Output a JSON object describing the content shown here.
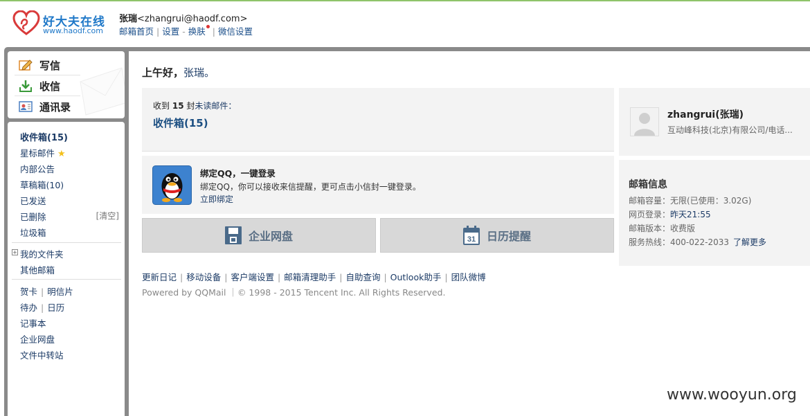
{
  "header": {
    "logo_name": "好大夫在线",
    "logo_url": "www.haodf.com",
    "user_name": "张瑞",
    "user_email": "<zhangrui@haodf.com>",
    "nav": [
      "邮箱首页",
      "设置",
      "换肤",
      "微信设置"
    ],
    "nav_dot_color": "#d33333"
  },
  "sidebar_top": {
    "compose": "写信",
    "receive": "收信",
    "contacts": "通讯录"
  },
  "sidebar": {
    "inbox": "收件箱(15)",
    "starred": "星标邮件",
    "notice": "内部公告",
    "drafts": "草稿箱(10)",
    "sent": "已发送",
    "deleted": "已删除",
    "clear": "[清空]",
    "trash": "垃圾箱",
    "my_folders": "我的文件夹",
    "other_mail": "其他邮箱",
    "card": "贺卡",
    "postcard": "明信片",
    "todo": "待办",
    "calendar": "日历",
    "notes": "记事本",
    "netdisk": "企业网盘",
    "transfer": "文件中转站"
  },
  "main": {
    "greeting": "上午好，",
    "greeting_name": "张瑞。",
    "unread_prefix": "收到",
    "unread_count": "15",
    "unread_mid": "封",
    "unread_suffix": "未读邮件：",
    "inbox_link": "收件箱(15)",
    "qq_title": "绑定QQ，一键登录",
    "qq_desc": "绑定QQ，你可以接收来信提醒，更可点击小信封一键登录。",
    "qq_link": "立即绑定",
    "btn_netdisk": "企业网盘",
    "btn_calendar": "日历提醒",
    "calendar_icon_num": "31",
    "footer_links": [
      "更新日记",
      "移动设备",
      "客户端设置",
      "邮箱清理助手",
      "自助查询",
      "Outlook助手",
      "团队微博"
    ],
    "powered": "Powered by QQMail ｜© 1998 - 2015 Tencent Inc. All Rights Reserved."
  },
  "profile": {
    "name": "zhangrui(张瑞)",
    "company": "互动峰科技(北京)有限公司/电话..."
  },
  "mailbox_info": {
    "title": "邮箱信息",
    "capacity_label": "邮箱容量：",
    "capacity_value": "无限(已使用：3.02G)",
    "login_label": "网页登录：",
    "login_value": "昨天21:55",
    "version_label": "邮箱版本：",
    "version_value": "收费版",
    "hotline_label": "服务热线：",
    "hotline_value": "400-022-2033",
    "more_link": "了解更多"
  },
  "watermark": "www.wooyun.org"
}
